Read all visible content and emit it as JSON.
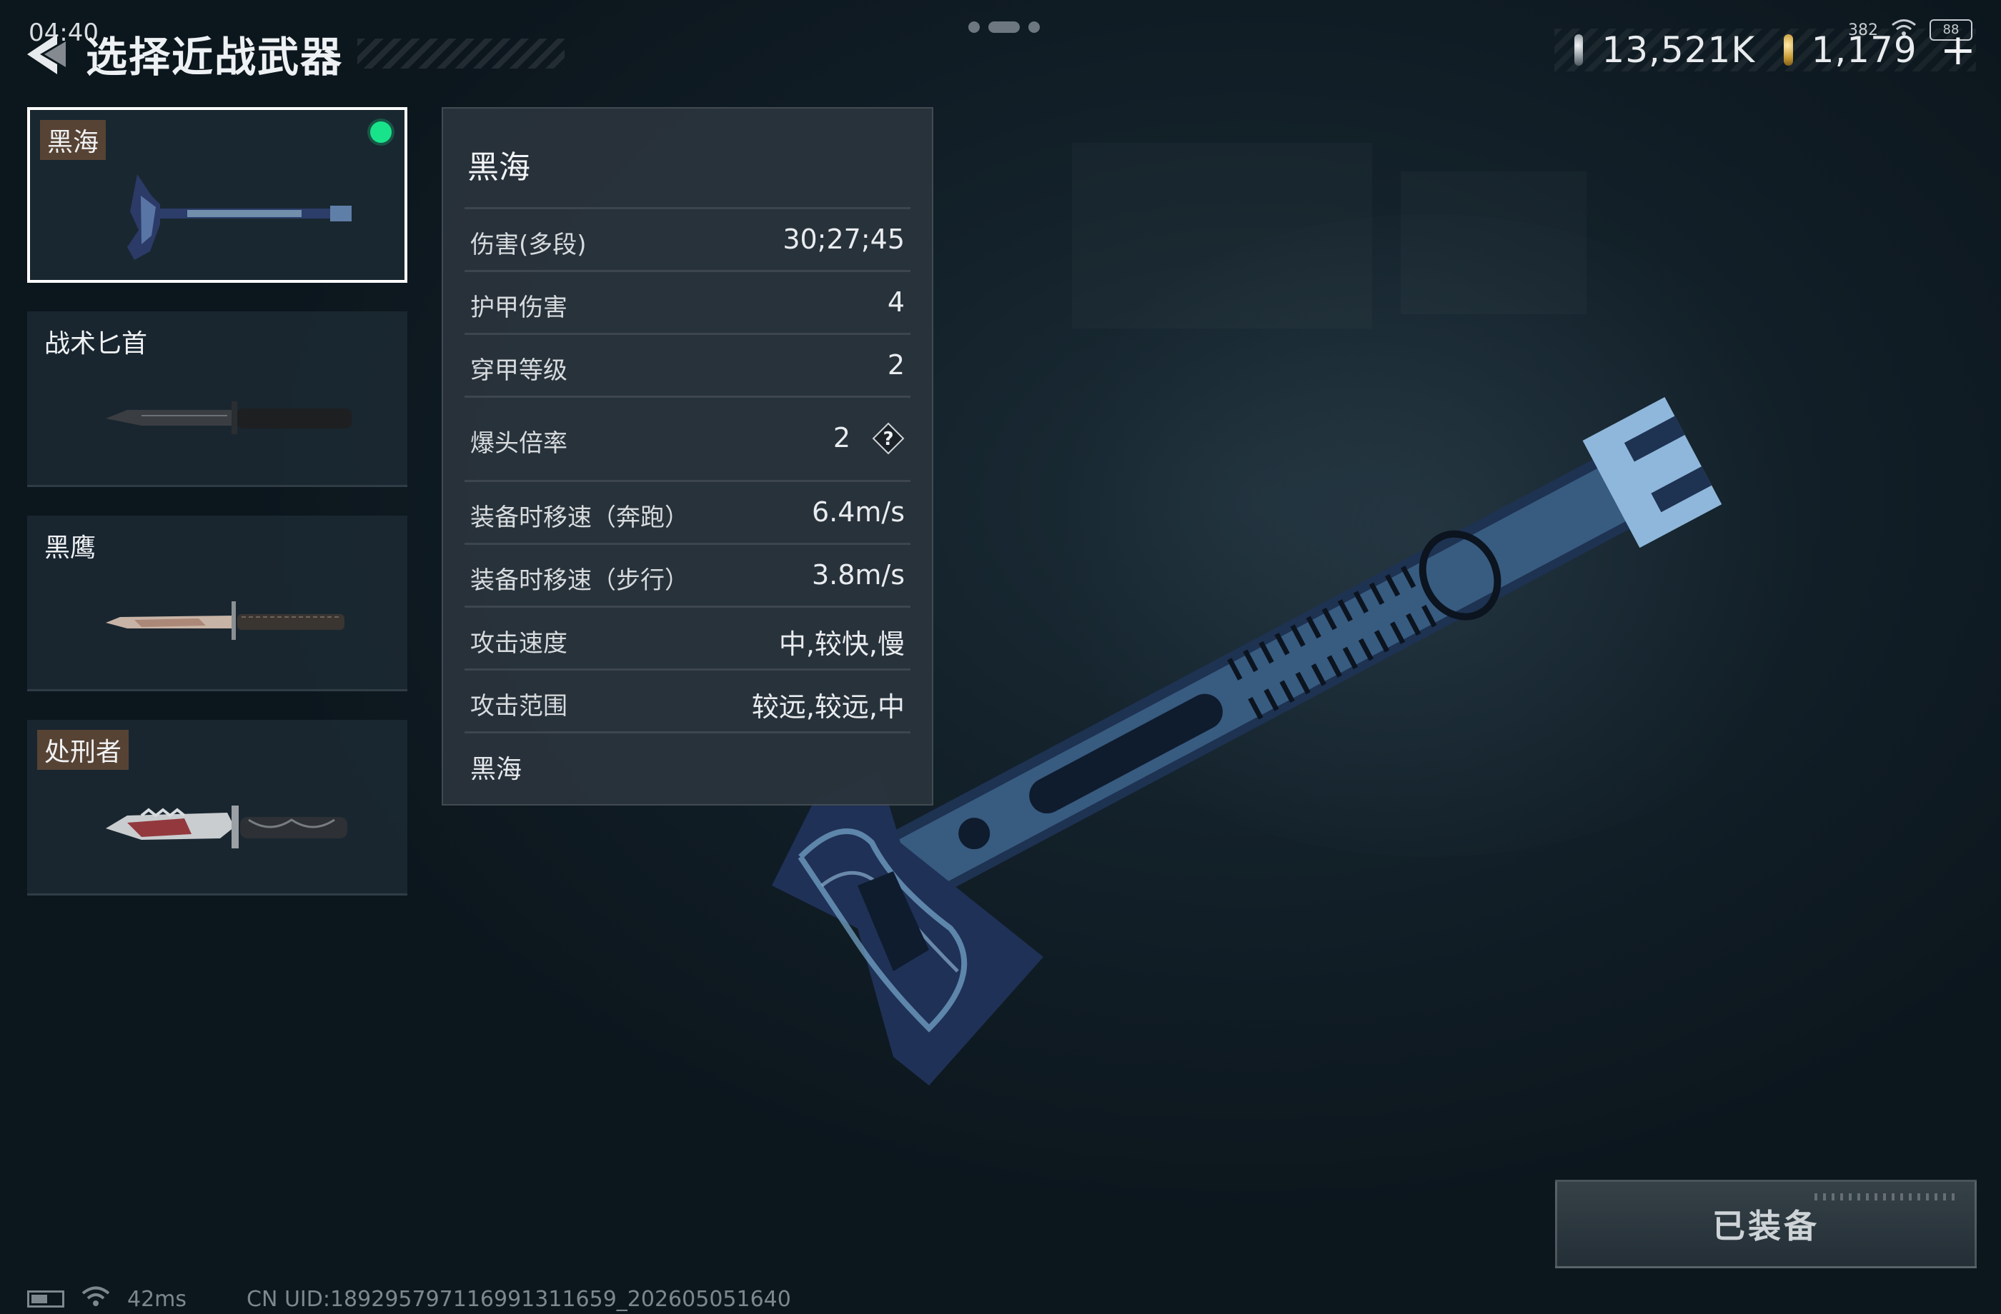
{
  "status_bar": {
    "time": "04:40",
    "network_speed": "382",
    "battery": "88"
  },
  "header": {
    "title": "选择近战武器"
  },
  "currency": {
    "silver_value": "13,521K",
    "gold_value": "1,179",
    "add_label": "+"
  },
  "weapons": [
    {
      "label": "黑海",
      "selected": true,
      "equipped": true
    },
    {
      "label": "战术匕首",
      "selected": false,
      "equipped": false
    },
    {
      "label": "黑鹰",
      "selected": false,
      "equipped": false
    },
    {
      "label": "处刑者",
      "selected": false,
      "equipped": false
    }
  ],
  "stats": {
    "title": "黑海",
    "rows": [
      {
        "name": "伤害(多段)",
        "value": "30;27;45"
      },
      {
        "name": "护甲伤害",
        "value": "4"
      },
      {
        "name": "穿甲等级",
        "value": "2"
      },
      {
        "name": "爆头倍率",
        "value": "2",
        "help": "?"
      },
      {
        "name": "装备时移速（奔跑）",
        "value": "6.4m/s"
      },
      {
        "name": "装备时移速（步行）",
        "value": "3.8m/s"
      },
      {
        "name": "攻击速度",
        "value": "中,较快,慢"
      },
      {
        "name": "攻击范围",
        "value": "较远,较远,中"
      }
    ],
    "footer": "黑海"
  },
  "equip_button": {
    "label": "已装备"
  },
  "bottom": {
    "ping": "42ms",
    "uid": "CN UID:18929579711699131165​9_202605051640"
  },
  "colors": {
    "equipped_indicator": "#19e38a",
    "background": "#13212a",
    "panel": "#2a343c",
    "tag": "#6c4e36"
  }
}
